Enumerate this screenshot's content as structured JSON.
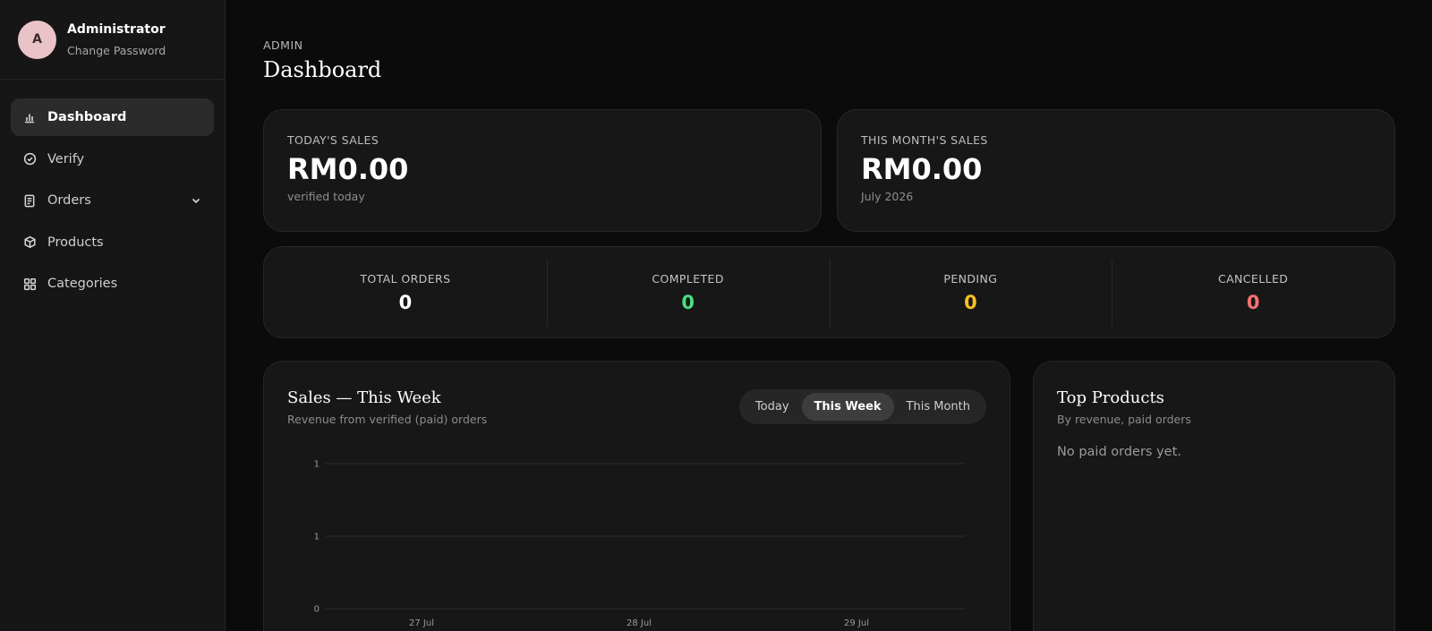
{
  "profile": {
    "initial": "A",
    "name": "Administrator",
    "link": "Change Password"
  },
  "sidebar": {
    "items": [
      {
        "label": "Dashboard",
        "icon": "bar-chart-icon",
        "active": true
      },
      {
        "label": "Verify",
        "icon": "check-circle-icon"
      },
      {
        "label": "Orders",
        "icon": "document-icon",
        "has_chevron": true
      },
      {
        "label": "Products",
        "icon": "box-icon"
      },
      {
        "label": "Categories",
        "icon": "grid-icon"
      }
    ]
  },
  "header": {
    "eyebrow": "ADMIN",
    "title": "Dashboard"
  },
  "sales": {
    "today": {
      "label": "TODAY'S SALES",
      "amount": "RM0.00",
      "sub": "verified today"
    },
    "month": {
      "label": "THIS MONTH'S SALES",
      "amount": "RM0.00",
      "sub": "July 2026"
    }
  },
  "stats": [
    {
      "label": "TOTAL ORDERS",
      "value": "0",
      "color": "#ffffff"
    },
    {
      "label": "COMPLETED",
      "value": "0",
      "color": "#4ade80"
    },
    {
      "label": "PENDING",
      "value": "0",
      "color": "#fbbf24"
    },
    {
      "label": "CANCELLED",
      "value": "0",
      "color": "#f87171"
    }
  ],
  "chart_panel": {
    "title": "Sales — This Week",
    "subtitle": "Revenue from verified (paid) orders",
    "tabs": [
      "Today",
      "This Week",
      "This Month"
    ],
    "active_tab": "This Week"
  },
  "chart_data": {
    "type": "line",
    "title": "Sales — This Week",
    "xlabel": "",
    "ylabel": "",
    "y_tick_labels": [
      "1",
      "1",
      "0"
    ],
    "x_tick_labels": [
      "27 Jul",
      "28 Jul",
      "29 Jul"
    ],
    "series": [],
    "grid": true
  },
  "top_products": {
    "title": "Top Products",
    "subtitle": "By revenue, paid orders",
    "empty": "No paid orders yet."
  }
}
